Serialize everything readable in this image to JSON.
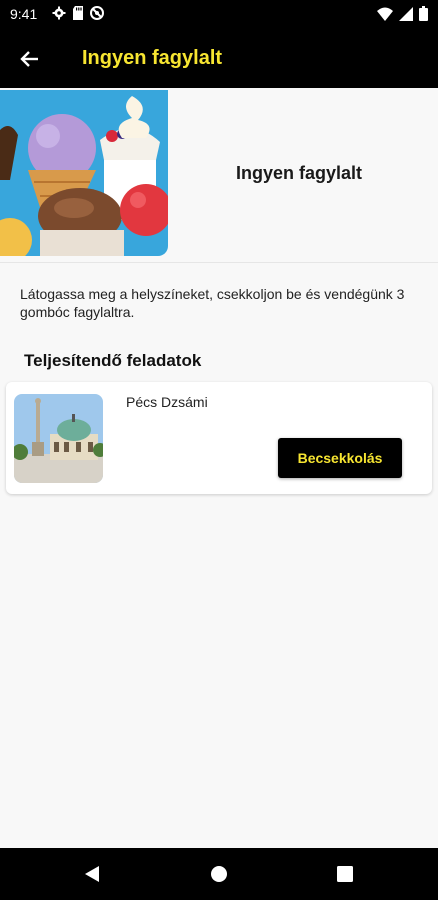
{
  "status_bar": {
    "time": "9:41",
    "icons_left": [
      "gear-icon",
      "sd-card-icon",
      "no-disturb-icon"
    ],
    "icons_right": [
      "wifi-icon",
      "cellular-signal-icon",
      "battery-icon"
    ]
  },
  "app_bar": {
    "title": "Ingyen fagylalt",
    "back_icon": "arrow-back-icon",
    "background": "#000000",
    "title_color": "#f7e531"
  },
  "hero": {
    "image": "ice-cream-photo",
    "title": "Ingyen fagylalt"
  },
  "description": "Látogassa meg a helyszíneket, csekkoljon be és vendégünk 3 gombóc fagylaltra.",
  "tasks": {
    "heading": "Teljesítendő feladatok",
    "items": [
      {
        "name": "Pécs Dzsámi",
        "image": "mosque-photo",
        "button_label": "Becsekkolás"
      }
    ]
  },
  "nav_bar": {
    "icons": [
      "nav-back-icon",
      "nav-home-icon",
      "nav-recents-icon"
    ]
  }
}
